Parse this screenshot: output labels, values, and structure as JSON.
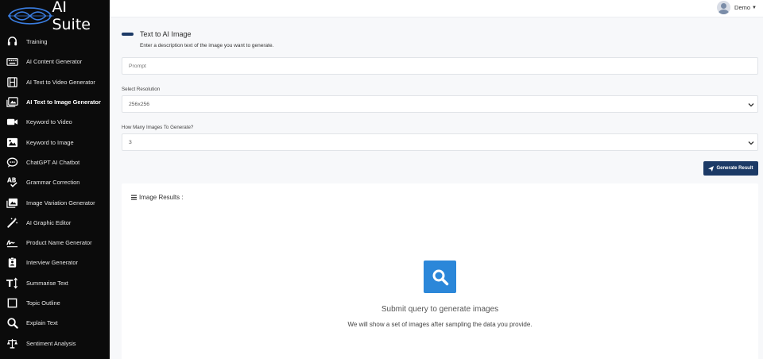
{
  "brand": {
    "name": "AI Suite"
  },
  "user": {
    "name": "Demo"
  },
  "sidebar": {
    "items": [
      {
        "label": "Training",
        "icon": "headset-icon"
      },
      {
        "label": "AI Content Generator",
        "icon": "keyboard-icon"
      },
      {
        "label": "AI Text to Video Generator",
        "icon": "film-icon"
      },
      {
        "label": "AI Text to Image Generator",
        "icon": "image-gallery-icon",
        "active": true
      },
      {
        "label": "Keyword to Video",
        "icon": "video-camera-icon"
      },
      {
        "label": "Keyword to Image",
        "icon": "image-icon"
      },
      {
        "label": "ChatGPT AI Chatbot",
        "icon": "chat-bubble-icon"
      },
      {
        "label": "Grammar Correction",
        "icon": "spellcheck-icon"
      },
      {
        "label": "Image Variation Generator",
        "icon": "images-icon"
      },
      {
        "label": "AI Graphic Editor",
        "icon": "magic-wand-icon"
      },
      {
        "label": "Product Name Generator",
        "icon": "signature-icon"
      },
      {
        "label": "Interview Generator",
        "icon": "clipboard-user-icon"
      },
      {
        "label": "Summarise Text",
        "icon": "text-height-icon"
      },
      {
        "label": "Topic Outline",
        "icon": "square-outline-icon"
      },
      {
        "label": "Explain Text",
        "icon": "magnifier-icon"
      },
      {
        "label": "Sentiment Analysis",
        "icon": "scale-icon"
      }
    ]
  },
  "main": {
    "title": "Text to AI Image",
    "subtitle": "Enter a description text of the image you want to generate.",
    "prompt_placeholder": "Prompt",
    "resolution_label": "Select Resolution",
    "resolution_value": "256x256",
    "count_label": "How Many Images To Generate?",
    "count_value": "3",
    "generate_label": "Generate Result",
    "results_title": "Image Results :",
    "empty_title": "Submit query to generate images",
    "empty_sub": "We will show a set of images after sampling the data you provide."
  },
  "colors": {
    "sidebar_bg": "#0b0b0b",
    "primary": "#1c3a66",
    "accent": "#2b87d9"
  }
}
